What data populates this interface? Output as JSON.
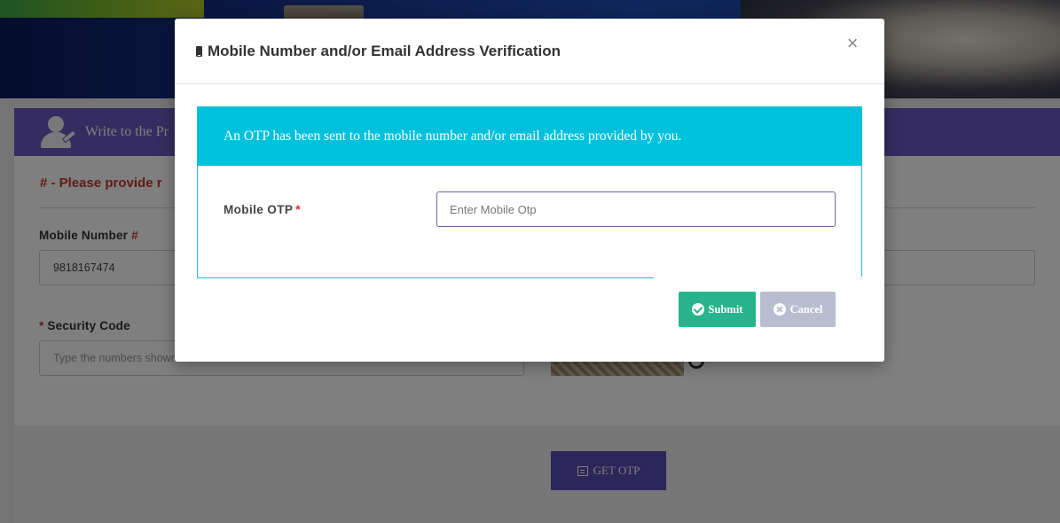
{
  "background": {
    "panel_title": "Write to the Pr",
    "note": "# - Please provide r",
    "mobile_label": "Mobile Number",
    "mobile_value": "9818167474",
    "security_label": "Security Code",
    "security_placeholder": "Type the numbers shown",
    "get_otp_label": "GET OTP"
  },
  "modal": {
    "title": "Mobile Number and/or Email Address Verification",
    "title_icon": "mobile-phone-icon",
    "close_glyph": "×",
    "alert_text": "An OTP has been sent to the mobile number and/or email address provided by you.",
    "otp_label": "Mobile OTP",
    "required_marker": "*",
    "otp_placeholder": "Enter Mobile Otp",
    "otp_value": "",
    "submit_label": "Submit",
    "cancel_label": "Cancel"
  },
  "colors": {
    "alert_bg": "#00c1dc",
    "submit_bg": "#27b48a",
    "cancel_bg": "#b9bdd0",
    "header_purple": "#6a5bc0",
    "required": "#e02424"
  }
}
